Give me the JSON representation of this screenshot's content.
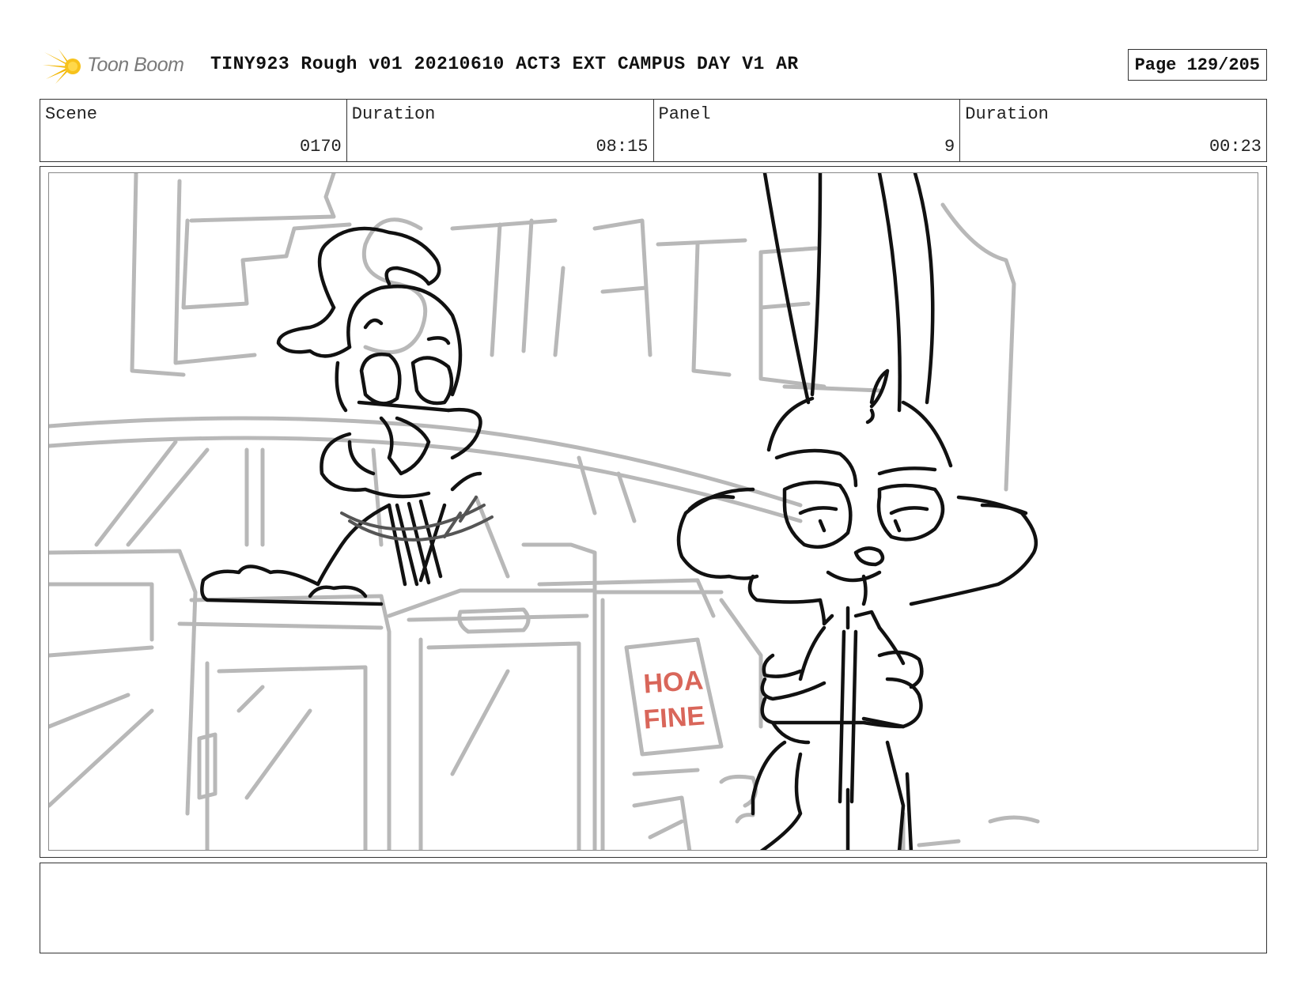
{
  "header": {
    "brand": "Toon Boom",
    "title": "TINY923 Rough v01 20210610 ACT3 EXT CAMPUS DAY V1 AR",
    "page": "Page 129/205"
  },
  "info": [
    {
      "label": "Scene",
      "value": "0170"
    },
    {
      "label": "Duration",
      "value": "08:15"
    },
    {
      "label": "Panel",
      "value": "9"
    },
    {
      "label": "Duration",
      "value": "00:23"
    }
  ],
  "panel": {
    "sign_lines": [
      "HOA",
      "FINE"
    ],
    "sign_color": "#d9665a"
  },
  "notes": ""
}
